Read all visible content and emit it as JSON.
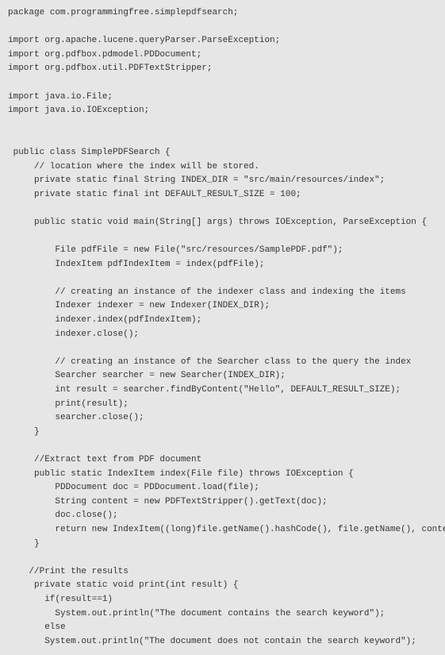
{
  "code": {
    "lines": [
      "package com.programmingfree.simplepdfsearch;",
      "",
      "import org.apache.lucene.queryParser.ParseException;",
      "import org.pdfbox.pdmodel.PDDocument;",
      "import org.pdfbox.util.PDFTextStripper;",
      "",
      "import java.io.File;",
      "import java.io.IOException;",
      "",
      "",
      " public class SimplePDFSearch {",
      "     // location where the index will be stored.",
      "     private static final String INDEX_DIR = \"src/main/resources/index\";",
      "     private static final int DEFAULT_RESULT_SIZE = 100;",
      "",
      "     public static void main(String[] args) throws IOException, ParseException {",
      "",
      "         File pdfFile = new File(\"src/resources/SamplePDF.pdf\");",
      "         IndexItem pdfIndexItem = index(pdfFile);",
      "",
      "         // creating an instance of the indexer class and indexing the items",
      "         Indexer indexer = new Indexer(INDEX_DIR);",
      "         indexer.index(pdfIndexItem);",
      "         indexer.close();",
      "",
      "         // creating an instance of the Searcher class to the query the index",
      "         Searcher searcher = new Searcher(INDEX_DIR);",
      "         int result = searcher.findByContent(\"Hello\", DEFAULT_RESULT_SIZE);",
      "         print(result);",
      "         searcher.close();",
      "     }",
      "",
      "     //Extract text from PDF document",
      "     public static IndexItem index(File file) throws IOException {",
      "         PDDocument doc = PDDocument.load(file);",
      "         String content = new PDFTextStripper().getText(doc);",
      "         doc.close();",
      "         return new IndexItem((long)file.getName().hashCode(), file.getName(), content)",
      "     }",
      "",
      "    //Print the results",
      "     private static void print(int result) {",
      "       if(result==1)",
      "         System.out.println(\"The document contains the search keyword\");",
      "       else",
      "       System.out.println(\"The document does not contain the search keyword\");"
    ]
  }
}
